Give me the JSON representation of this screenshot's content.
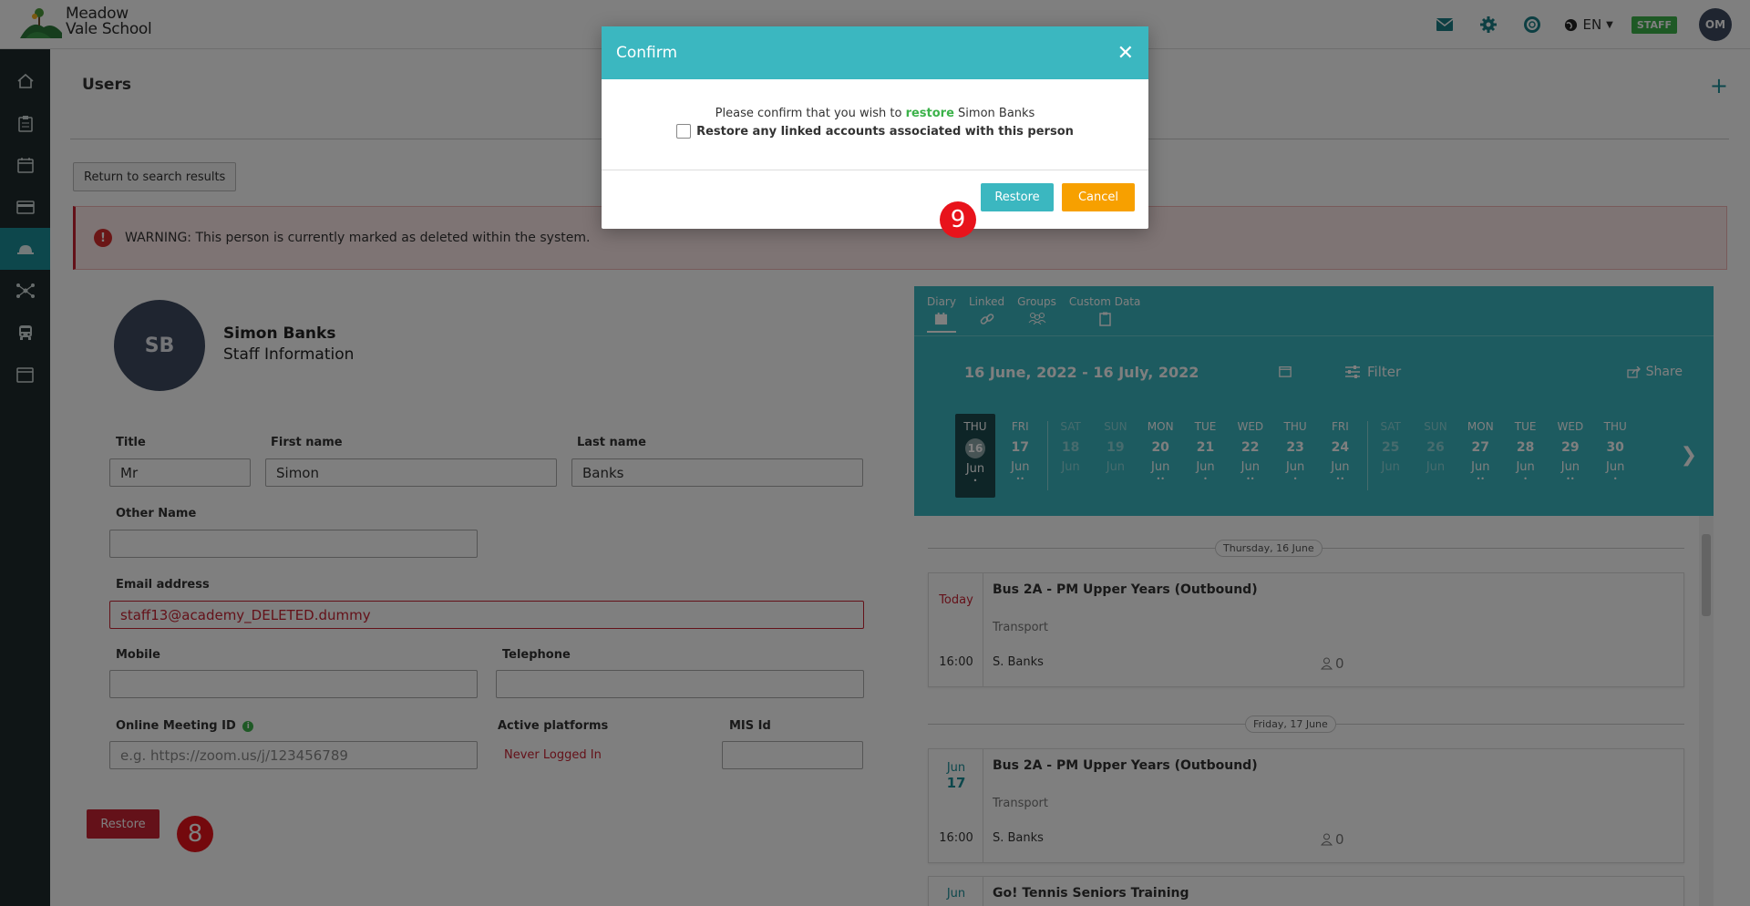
{
  "header": {
    "logo_line1": "Meadow",
    "logo_line2": "Vale School",
    "language": "EN",
    "staff_badge": "STAFF",
    "user_initials": "OM",
    "icons": [
      "mail-icon",
      "gear-icon",
      "help-lifebuoy-icon",
      "globe-icon"
    ]
  },
  "sidebar": {
    "items": [
      "home-icon",
      "clipboard-icon",
      "calendar-icon",
      "card-icon",
      "service-bell-icon",
      "network-icon",
      "bus-icon",
      "window-icon"
    ],
    "active_index": 4
  },
  "page": {
    "title": "Users",
    "return_button": "Return to search results",
    "warning": "WARNING: This person is currently marked as deleted within the system."
  },
  "person": {
    "initials": "SB",
    "name": "Simon Banks",
    "subtitle": "Staff Information"
  },
  "form": {
    "title_label": "Title",
    "title_value": "Mr",
    "first_name_label": "First name",
    "first_name_value": "Simon",
    "last_name_label": "Last name",
    "last_name_value": "Banks",
    "other_name_label": "Other Name",
    "other_name_value": "",
    "email_label": "Email address",
    "email_value": "staff13@academy_DELETED.dummy",
    "mobile_label": "Mobile",
    "mobile_value": "",
    "telephone_label": "Telephone",
    "telephone_value": "",
    "meeting_label": "Online Meeting ID",
    "meeting_placeholder": "e.g. https://zoom.us/j/123456789",
    "platforms_label": "Active platforms",
    "platforms_value": "Never Logged In",
    "mis_label": "MIS Id",
    "mis_value": "",
    "restore_button": "Restore"
  },
  "steps": {
    "step_main": "8",
    "step_modal": "9"
  },
  "diary": {
    "tabs": [
      {
        "label": "Diary",
        "icon": "calendar-icon"
      },
      {
        "label": "Linked",
        "icon": "link-icon"
      },
      {
        "label": "Groups",
        "icon": "group-icon"
      },
      {
        "label": "Custom Data",
        "icon": "clipboard-icon"
      }
    ],
    "range": "16 June, 2022 - 16 July, 2022",
    "filter": "Filter",
    "share": "Share",
    "days": [
      {
        "name": "THU",
        "num": "16",
        "mon": "Jun",
        "dots": "•",
        "today": true,
        "dim": false
      },
      {
        "name": "FRI",
        "num": "17",
        "mon": "Jun",
        "dots": "••",
        "today": false,
        "dim": false
      },
      {
        "name": "SAT",
        "num": "18",
        "mon": "Jun",
        "dots": "",
        "today": false,
        "dim": true
      },
      {
        "name": "SUN",
        "num": "19",
        "mon": "Jun",
        "dots": "",
        "today": false,
        "dim": true
      },
      {
        "name": "MON",
        "num": "20",
        "mon": "Jun",
        "dots": "••",
        "today": false,
        "dim": false
      },
      {
        "name": "TUE",
        "num": "21",
        "mon": "Jun",
        "dots": "•",
        "today": false,
        "dim": false
      },
      {
        "name": "WED",
        "num": "22",
        "mon": "Jun",
        "dots": "••",
        "today": false,
        "dim": false
      },
      {
        "name": "THU",
        "num": "23",
        "mon": "Jun",
        "dots": "•",
        "today": false,
        "dim": false
      },
      {
        "name": "FRI",
        "num": "24",
        "mon": "Jun",
        "dots": "••",
        "today": false,
        "dim": false
      },
      {
        "name": "SAT",
        "num": "25",
        "mon": "Jun",
        "dots": "",
        "today": false,
        "dim": true
      },
      {
        "name": "SUN",
        "num": "26",
        "mon": "Jun",
        "dots": "",
        "today": false,
        "dim": true
      },
      {
        "name": "MON",
        "num": "27",
        "mon": "Jun",
        "dots": "••",
        "today": false,
        "dim": false
      },
      {
        "name": "TUE",
        "num": "28",
        "mon": "Jun",
        "dots": "•",
        "today": false,
        "dim": false
      },
      {
        "name": "WED",
        "num": "29",
        "mon": "Jun",
        "dots": "••",
        "today": false,
        "dim": false
      },
      {
        "name": "THU",
        "num": "30",
        "mon": "Jun",
        "dots": "•",
        "today": false,
        "dim": false
      }
    ],
    "sections": [
      {
        "date_label": "Thursday, 16 June",
        "event": {
          "date_top": "Today",
          "date_bottom": "",
          "time": "16:00",
          "title": "Bus 2A - PM Upper Years (Outbound)",
          "type": "Transport",
          "staff": "S. Banks",
          "count": "0"
        }
      },
      {
        "date_label": "Friday, 17 June",
        "event": {
          "date_top": "Jun",
          "date_bottom": "17",
          "time": "16:00",
          "title": "Bus 2A - PM Upper Years (Outbound)",
          "type": "Transport",
          "staff": "S. Banks",
          "count": "0"
        }
      }
    ],
    "partial_event": {
      "date_top": "Jun",
      "title": "Go! Tennis Seniors Training"
    }
  },
  "modal": {
    "title": "Confirm",
    "line1_pre": "Please confirm that you wish to",
    "line1_action": "restore",
    "line1_name": "Simon Banks",
    "checkbox_label": "Restore any linked accounts associated with this person",
    "restore_button": "Restore",
    "cancel_button": "Cancel"
  },
  "colors": {
    "teal": "#3bb7c0",
    "danger": "#c82333",
    "cancel": "#f7a000",
    "success": "#3cb24a",
    "nav_bg": "#1f2b2d"
  }
}
